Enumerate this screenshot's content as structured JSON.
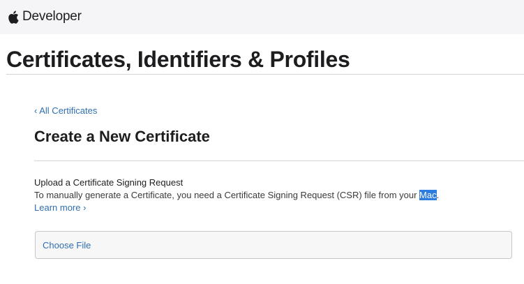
{
  "header": {
    "brand_icon": "apple-logo-icon",
    "brand_text": "Developer"
  },
  "page": {
    "title": "Certificates, Identifiers & Profiles"
  },
  "nav": {
    "back_chevron": "‹",
    "back_label": "All Certificates"
  },
  "section": {
    "title": "Create a New Certificate"
  },
  "upload": {
    "heading": "Upload a Certificate Signing Request",
    "description_before": "To manually generate a Certificate, you need a Certificate Signing Request (CSR) file from your ",
    "description_selected": "Mac",
    "description_after": ".",
    "learn_more_label": "Learn more",
    "learn_more_chevron": "›",
    "choose_file_label": "Choose File"
  },
  "colors": {
    "accent_link": "#2f6fb0",
    "selection": "#2d7ce0",
    "header_bg": "#f5f5f7"
  }
}
